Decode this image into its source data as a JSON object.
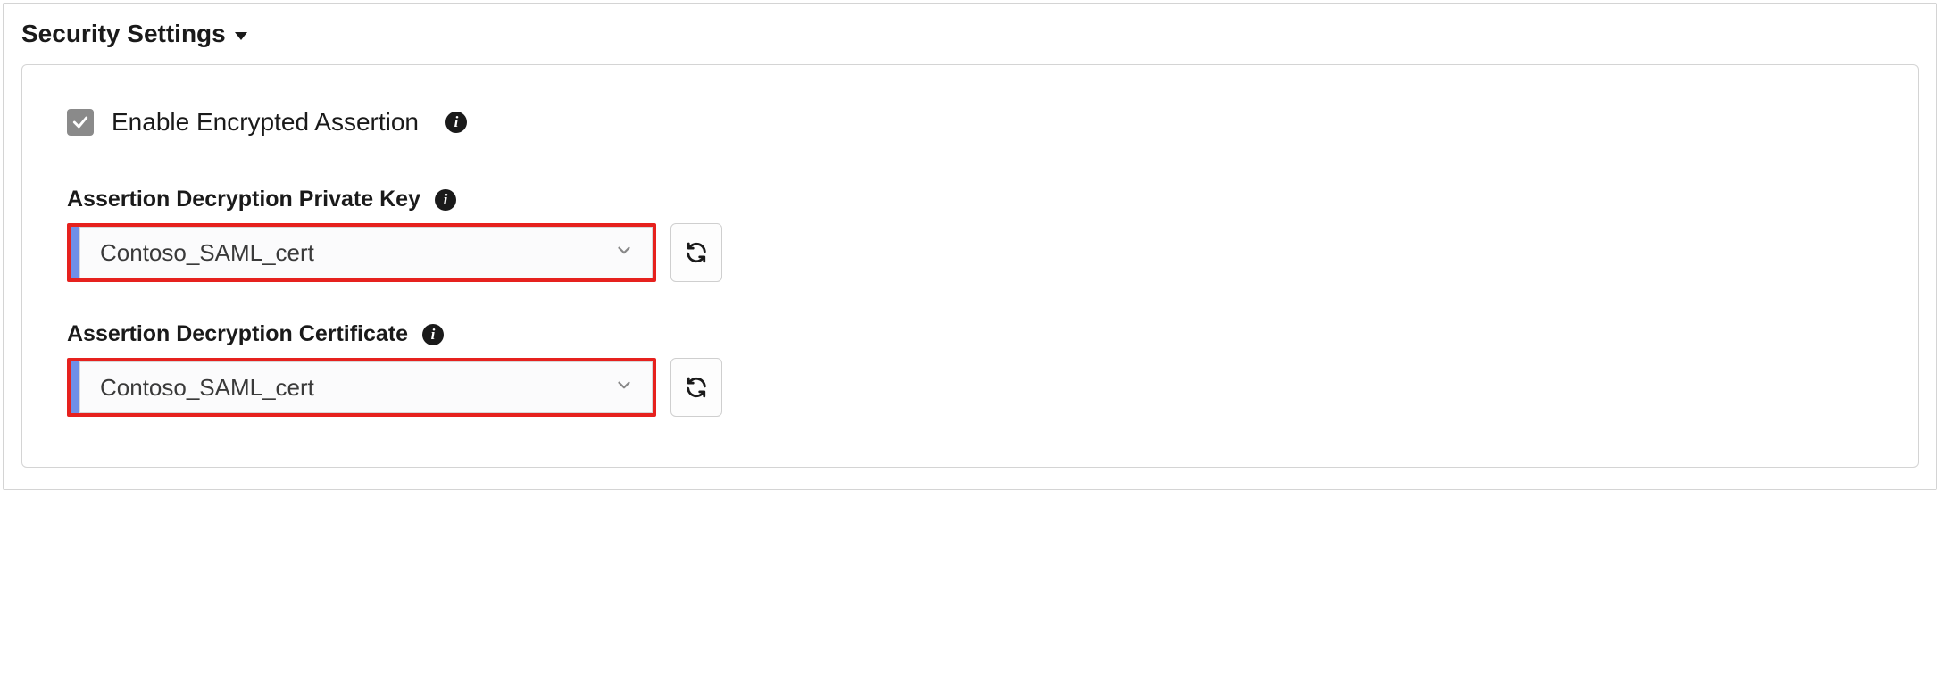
{
  "section": {
    "title": "Security Settings"
  },
  "checkbox": {
    "label": "Enable Encrypted Assertion",
    "checked": true
  },
  "fields": {
    "privateKey": {
      "label": "Assertion Decryption Private Key",
      "value": "Contoso_SAML_cert"
    },
    "certificate": {
      "label": "Assertion Decryption Certificate",
      "value": "Contoso_SAML_cert"
    }
  },
  "highlight_color": "#e6211e",
  "icons": {
    "info": "i"
  }
}
